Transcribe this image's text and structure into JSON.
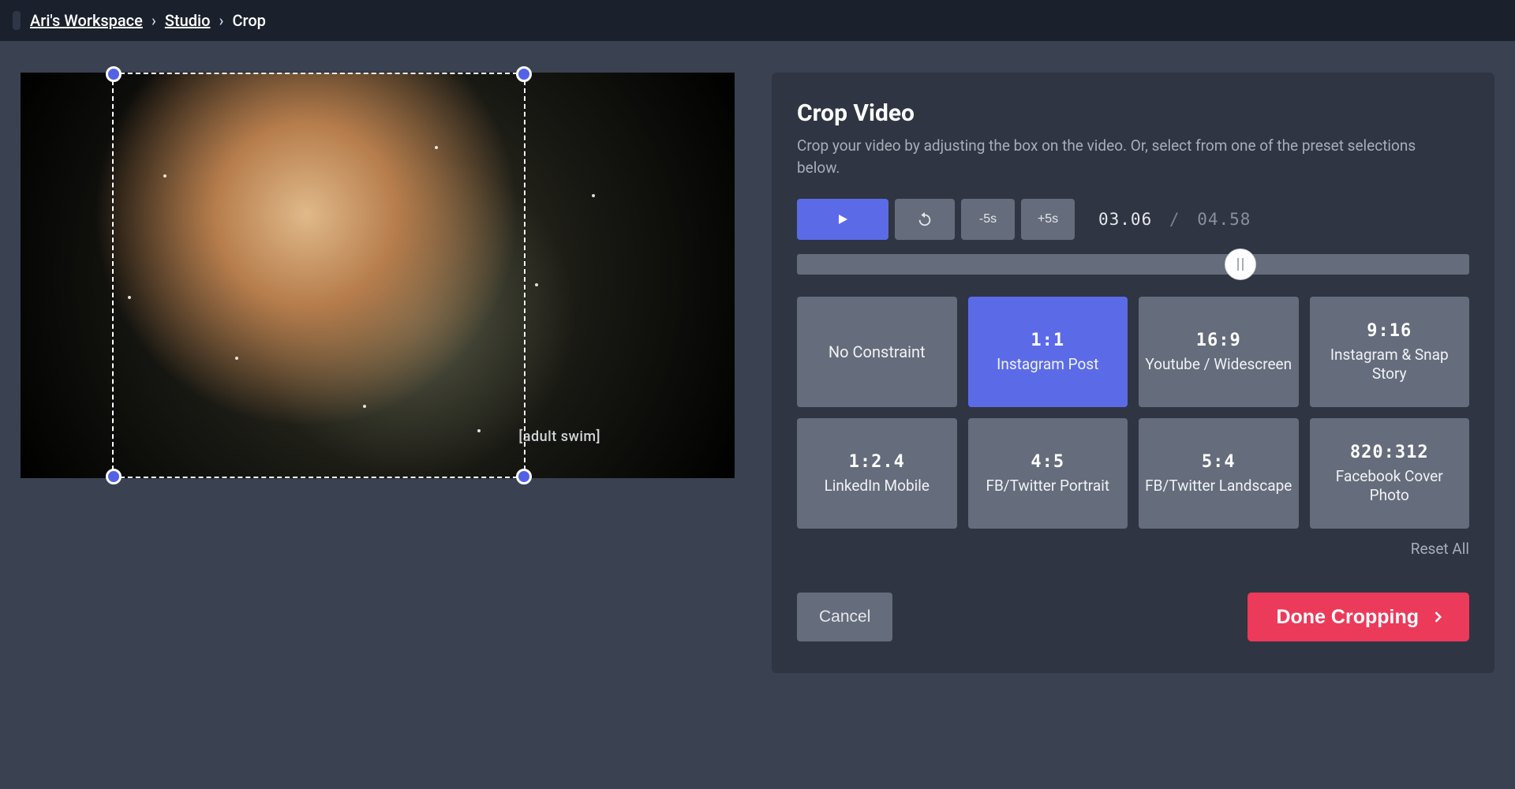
{
  "breadcrumb": {
    "workspace": "Ari's Workspace",
    "studio": "Studio",
    "current": "Crop"
  },
  "video": {
    "watermark": "[adult swim]"
  },
  "panel": {
    "title": "Crop Video",
    "description": "Crop your video by adjusting the box on the video. Or, select from one of the preset selections below."
  },
  "controls": {
    "back5": "-5s",
    "fwd5": "+5s",
    "current_time": "03.06",
    "sep": "/",
    "total_time": "04.58",
    "progress_pct": 66
  },
  "presets": [
    {
      "ratio": "",
      "label": "No Constraint",
      "selected": false
    },
    {
      "ratio": "1:1",
      "label": "Instagram Post",
      "selected": true
    },
    {
      "ratio": "16:9",
      "label": "Youtube / Widescreen",
      "selected": false
    },
    {
      "ratio": "9:16",
      "label": "Instagram & Snap Story",
      "selected": false
    },
    {
      "ratio": "1:2.4",
      "label": "LinkedIn Mobile",
      "selected": false
    },
    {
      "ratio": "4:5",
      "label": "FB/Twitter Portrait",
      "selected": false
    },
    {
      "ratio": "5:4",
      "label": "FB/Twitter Landscape",
      "selected": false
    },
    {
      "ratio": "820:312",
      "label": "Facebook Cover Photo",
      "selected": false
    }
  ],
  "reset_all": "Reset All",
  "footer": {
    "cancel": "Cancel",
    "done": "Done Cropping"
  }
}
